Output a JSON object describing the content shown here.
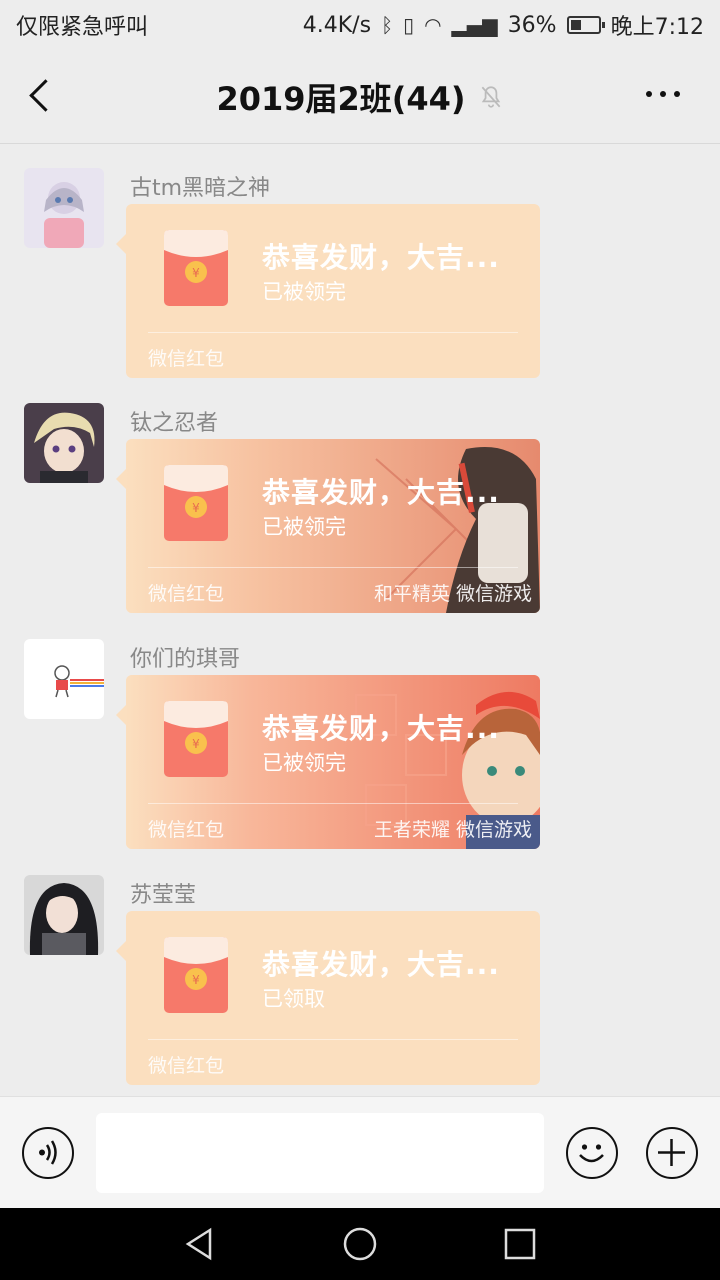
{
  "status_bar": {
    "carrier": "仅限紧急呼叫",
    "speed": "4.4K/s",
    "battery": "36%",
    "battery_level": 0.36,
    "time": "晚上7:12"
  },
  "header": {
    "title": "2019届2班(44)",
    "back_icon": "chevron-left-icon",
    "mute_icon": "bell-off-icon",
    "more_icon": "more-dots-icon"
  },
  "messages": [
    {
      "sender": "古tm黑暗之神",
      "title": "恭喜发财，大吉...",
      "status": "已被领完",
      "footer": "微信红包",
      "game": ""
    },
    {
      "sender": "钛之忍者",
      "title": "恭喜发财，大吉...",
      "status": "已被领完",
      "footer": "微信红包",
      "game": "和平精英 微信游戏"
    },
    {
      "sender": "你们的琪哥",
      "title": "恭喜发财，大吉...",
      "status": "已被领完",
      "footer": "微信红包",
      "game": "王者荣耀 微信游戏"
    },
    {
      "sender": "苏莹莹",
      "title": "恭喜发财，大吉...",
      "status": "已领取",
      "footer": "微信红包",
      "game": ""
    }
  ],
  "input_bar": {
    "voice_icon": "voice-icon",
    "text_value": "",
    "emoji_icon": "emoji-icon",
    "plus_icon": "plus-icon"
  },
  "colors": {
    "packet_bg": "#fbdfbf",
    "envelope": "#f6796a",
    "coin": "#f9c14d"
  }
}
